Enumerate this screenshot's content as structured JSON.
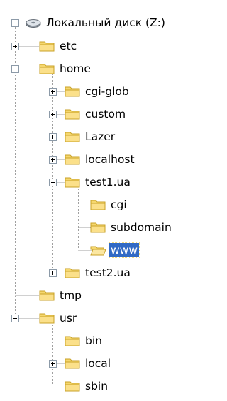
{
  "tree": {
    "root": {
      "label": "Локальный диск (Z:)",
      "icon": "drive-icon",
      "expanded": true
    },
    "nodes": [
      {
        "label": "etc",
        "icon": "folder-closed-icon",
        "level": 1,
        "toggle": "plus"
      },
      {
        "label": "home",
        "icon": "folder-closed-icon",
        "level": 1,
        "toggle": "minus"
      },
      {
        "label": "cgi-glob",
        "icon": "folder-closed-icon",
        "level": 2,
        "toggle": "plus"
      },
      {
        "label": "custom",
        "icon": "folder-closed-icon",
        "level": 2,
        "toggle": "plus"
      },
      {
        "label": "Lazer",
        "icon": "folder-closed-icon",
        "level": 2,
        "toggle": "plus"
      },
      {
        "label": "localhost",
        "icon": "folder-closed-icon",
        "level": 2,
        "toggle": "plus"
      },
      {
        "label": "test1.ua",
        "icon": "folder-closed-icon",
        "level": 2,
        "toggle": "minus"
      },
      {
        "label": "cgi",
        "icon": "folder-closed-icon",
        "level": 3,
        "toggle": "none"
      },
      {
        "label": "subdomain",
        "icon": "folder-closed-icon",
        "level": 3,
        "toggle": "none"
      },
      {
        "label": "www",
        "icon": "folder-open-icon",
        "level": 3,
        "toggle": "none",
        "selected": true
      },
      {
        "label": "test2.ua",
        "icon": "folder-closed-icon",
        "level": 2,
        "toggle": "plus"
      },
      {
        "label": "tmp",
        "icon": "folder-closed-icon",
        "level": 1,
        "toggle": "none"
      },
      {
        "label": "usr",
        "icon": "folder-closed-icon",
        "level": 1,
        "toggle": "minus"
      },
      {
        "label": "bin",
        "icon": "folder-closed-icon",
        "level": 2,
        "toggle": "none"
      },
      {
        "label": "local",
        "icon": "folder-closed-icon",
        "level": 2,
        "toggle": "plus"
      },
      {
        "label": "sbin",
        "icon": "folder-closed-icon",
        "level": 2,
        "toggle": "none"
      }
    ]
  },
  "colors": {
    "selection": "#316ac5",
    "folder": "#f5d76e",
    "folder_edge": "#c9a227",
    "tree_line": "#a0a0a0"
  }
}
